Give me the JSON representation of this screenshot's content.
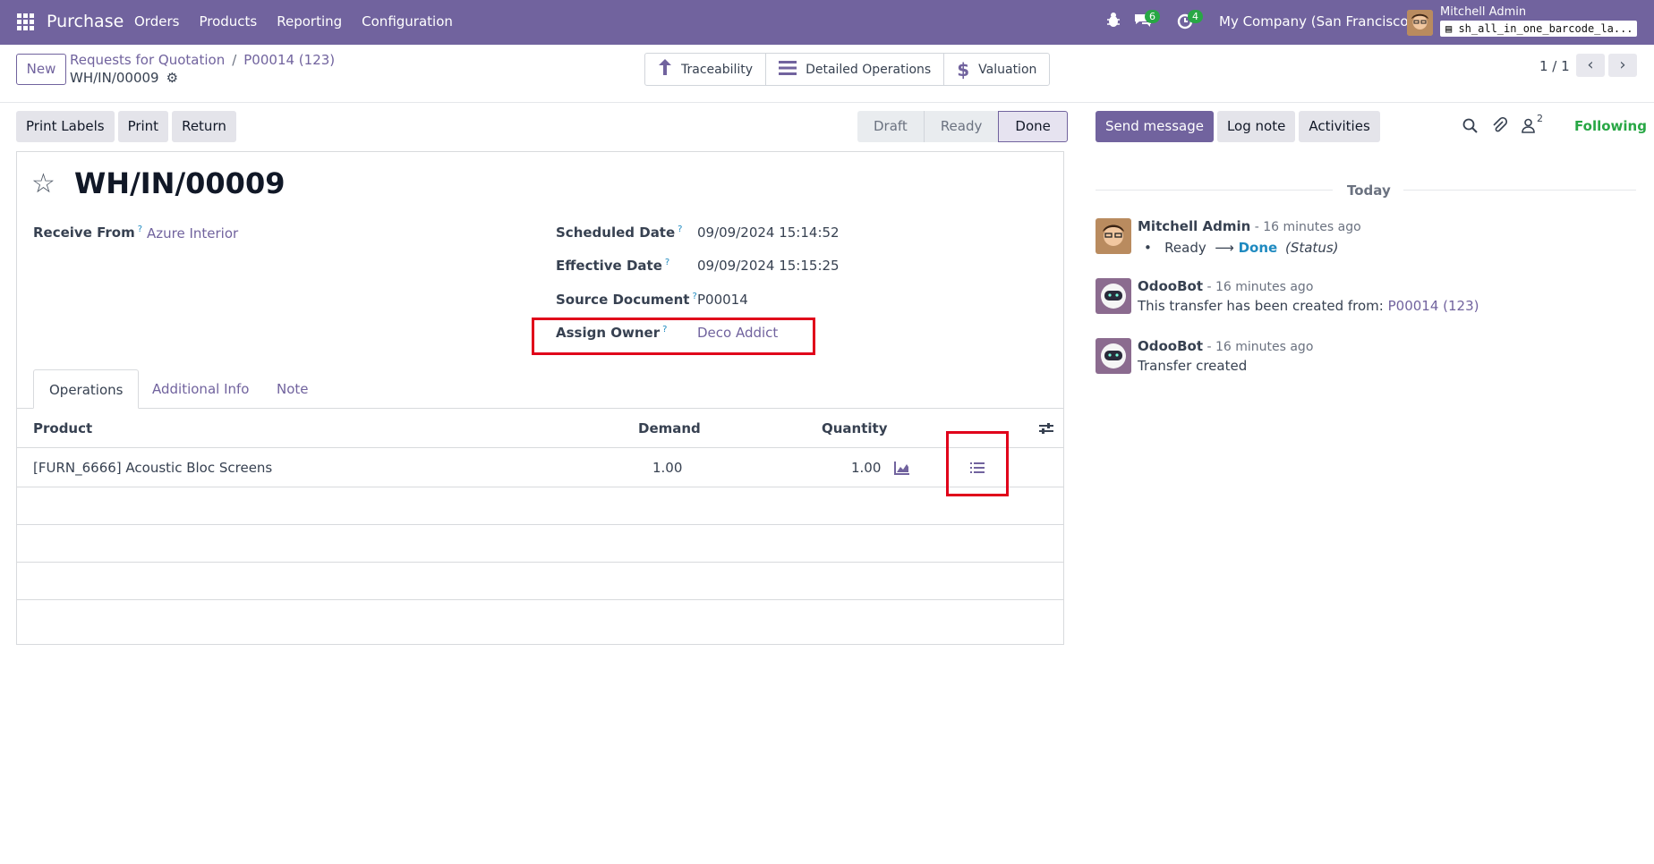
{
  "topbar": {
    "brand": "Purchase",
    "menu": [
      "Orders",
      "Products",
      "Reporting",
      "Configuration"
    ],
    "messages_count": "6",
    "activities_count": "4",
    "company": "My Company (San Francisco)",
    "user": "Mitchell Admin",
    "database": "sh_all_in_one_barcode_la..."
  },
  "control_panel": {
    "new_label": "New",
    "breadcrumb": [
      "Requests for Quotation",
      "P00014 (123)"
    ],
    "record": "WH/IN/00009",
    "smart_buttons": [
      "Traceability",
      "Detailed Operations",
      "Valuation"
    ],
    "pager": "1 / 1"
  },
  "statusbar": {
    "buttons": [
      "Print Labels",
      "Print",
      "Return"
    ],
    "stages": [
      "Draft",
      "Ready",
      "Done"
    ],
    "active_stage": "Done"
  },
  "form": {
    "title": "WH/IN/00009",
    "receive_from_label": "Receive From",
    "receive_from": "Azure Interior",
    "scheduled_date_label": "Scheduled Date",
    "scheduled_date": "09/09/2024 15:14:52",
    "effective_date_label": "Effective Date",
    "effective_date": "09/09/2024 15:15:25",
    "source_document_label": "Source Document",
    "source_document": "P00014",
    "assign_owner_label": "Assign Owner",
    "assign_owner": "Deco Addict",
    "help_mark": "?",
    "tabs": [
      "Operations",
      "Additional Info",
      "Note"
    ],
    "columns": [
      "Product",
      "Demand",
      "Quantity"
    ],
    "lines": [
      {
        "product": "[FURN_6666] Acoustic Bloc Screens",
        "demand": "1.00",
        "quantity": "1.00"
      }
    ]
  },
  "chatter": {
    "buttons": [
      "Send message",
      "Log note",
      "Activities"
    ],
    "followers_count": "2",
    "following": "Following",
    "today": "Today",
    "messages": [
      {
        "author": "Mitchell Admin",
        "time": " - 16 minutes ago",
        "from": "Ready",
        "to": "Done",
        "field": "(Status)"
      },
      {
        "author": "OdooBot",
        "time": " - 16 minutes ago",
        "text": "This transfer has been created from: ",
        "link": "P00014 (123)"
      },
      {
        "author": "OdooBot",
        "time": " - 16 minutes ago",
        "text": "Transfer created"
      }
    ]
  },
  "colors": {
    "brand": "#71639e",
    "highlight": "#e0001a",
    "following": "#28a745"
  }
}
